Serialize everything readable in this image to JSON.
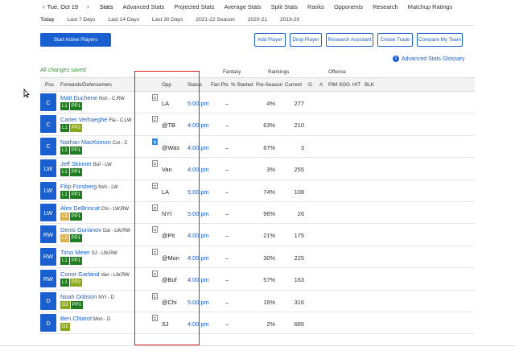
{
  "topnav": {
    "prev_arrow": "‹",
    "date": "Tue, Oct 19",
    "next_arrow": "›",
    "items": [
      "Stats",
      "Advanced Stats",
      "Projected Stats",
      "Average Stats",
      "Split Stats",
      "Ranks",
      "Opponents",
      "Research",
      "Matchup Ratings"
    ]
  },
  "subnav": {
    "items": [
      "Today",
      "Last 7 Days",
      "Last 14 Days",
      "Last 30 Days",
      "2021-22 Season",
      "2020-21",
      "2019-20"
    ]
  },
  "actions": {
    "start_active": "Start Active Players",
    "add_player": "Add Player",
    "drop_player": "Drop Player",
    "research_assistant": "Research Assistant",
    "create_trade": "Create Trade",
    "compare_team": "Compare My Team"
  },
  "glossary": {
    "icon": "i",
    "label": "Advanced Stats Glossary"
  },
  "saved_text": "All changes saved",
  "groups": {
    "fantasy": "Fantasy",
    "rankings": "Rankings",
    "offense": "Offense"
  },
  "columns": {
    "pos": "Pos",
    "player": "Forwards/Defensemen",
    "opp": "Opp",
    "status": "Status",
    "fan_pts": "Fan Pts",
    "pct_started": "% Started",
    "preseason": "Pre-Season",
    "current": "Current",
    "g": "G",
    "a": "A",
    "pim": "PIM",
    "sog": "SOG",
    "hit": "HIT",
    "blk": "BLK"
  },
  "colors": {
    "accent": "#1a5fd0",
    "line1": "#1e7d1e",
    "pp1": "#1e7d1e",
    "line2": "#8aa81e",
    "line3": "#d9b24a",
    "highlight": "#e02020"
  },
  "players": [
    {
      "pos": "C",
      "name": "Matt Duchene",
      "team": "Nsh - C,RW",
      "line": "L1",
      "pp": "PP1",
      "opp": "LA",
      "status": "5:00 pm",
      "fan_pts": "–",
      "started": "4%",
      "pre": "277",
      "note_active": false
    },
    {
      "pos": "C",
      "name": "Carter Verhaeghe",
      "team": "Fla - C,LW",
      "line": "L1",
      "pp": "PP2",
      "opp": "@TB",
      "status": "4:00 pm",
      "fan_pts": "–",
      "started": "63%",
      "pre": "210",
      "note_active": false
    },
    {
      "pos": "C",
      "name": "Nathan MacKinnon",
      "team": "Col - C",
      "line": "L1",
      "pp": "PP1",
      "opp": "@Was",
      "status": "4:00 pm",
      "fan_pts": "–",
      "started": "67%",
      "pre": "3",
      "note_active": true
    },
    {
      "pos": "LW",
      "name": "Jeff Skinner",
      "team": "Buf - LW",
      "line": "L1",
      "pp": "PP1",
      "opp": "Van",
      "status": "4:00 pm",
      "fan_pts": "–",
      "started": "3%",
      "pre": "255",
      "note_active": false
    },
    {
      "pos": "LW",
      "name": "Filip Forsberg",
      "team": "Nsh - LW",
      "line": "L1",
      "pp": "PP1",
      "opp": "LA",
      "status": "5:00 pm",
      "fan_pts": "–",
      "started": "74%",
      "pre": "108",
      "note_active": false
    },
    {
      "pos": "LW",
      "name": "Alex DeBrincat",
      "team": "Chi - LW,RW",
      "line": "L3",
      "pp": "PP1",
      "opp": "NYI",
      "status": "5:00 pm",
      "fan_pts": "–",
      "started": "96%",
      "pre": "26",
      "note_active": false
    },
    {
      "pos": "RW",
      "name": "Denis Gurianov",
      "team": "Dal - LW,RW",
      "line": "L3",
      "pp": "PP1",
      "opp": "@Pit",
      "status": "4:00 pm",
      "fan_pts": "–",
      "started": "21%",
      "pre": "175",
      "note_active": false
    },
    {
      "pos": "RW",
      "name": "Timo Meier",
      "team": "SJ - LW,RW",
      "line": "L1",
      "pp": "PP1",
      "opp": "@Mon",
      "status": "4:00 pm",
      "fan_pts": "–",
      "started": "30%",
      "pre": "225",
      "note_active": false
    },
    {
      "pos": "RW",
      "name": "Conor Garland",
      "team": "Van - LW,RW",
      "line": "L1",
      "pp": "PP2",
      "opp": "@Buf",
      "status": "4:00 pm",
      "fan_pts": "–",
      "started": "57%",
      "pre": "163",
      "note_active": false
    },
    {
      "pos": "D",
      "name": "Noah Dobson",
      "team": "NYI - D",
      "line": "D2",
      "pp": "PP1",
      "opp": "@Chi",
      "status": "5:00 pm",
      "fan_pts": "–",
      "started": "16%",
      "pre": "316",
      "note_active": false
    },
    {
      "pos": "D",
      "name": "Ben Chiarot",
      "team": "Mon - D",
      "line": "D2",
      "pp": "",
      "opp": "SJ",
      "status": "4:00 pm",
      "fan_pts": "–",
      "started": "2%",
      "pre": "685",
      "note_active": false
    }
  ]
}
